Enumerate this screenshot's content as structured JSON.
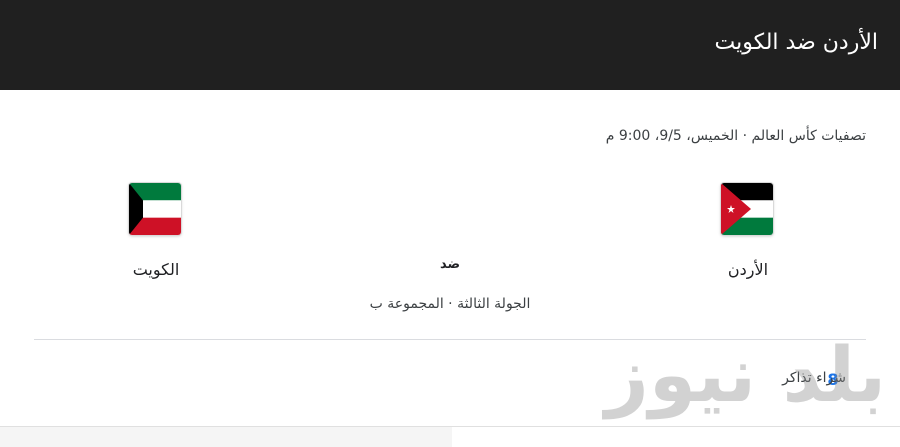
{
  "header": {
    "title": "الأردن ضد الكويت"
  },
  "match": {
    "info": "تصفيات كأس العالم · الخميس، 9/5، 9:00 م",
    "home": {
      "name": "الأردن",
      "flag": "jordan-flag-icon"
    },
    "away": {
      "name": "الكويت",
      "flag": "kuwait-flag-icon"
    },
    "vs": "ضد",
    "round": "الجولة الثالثة · المجموعة ب"
  },
  "tickets": {
    "label": "شراء تذاكر",
    "icon": "ticket-icon",
    "accent": "#1a73e8"
  },
  "watermark": {
    "text": "بلد نيوز"
  },
  "colors": {
    "header_bg": "#202020",
    "flag_black": "#000000",
    "flag_white": "#ffffff",
    "flag_green": "#007a3d",
    "flag_red": "#ce1126"
  }
}
